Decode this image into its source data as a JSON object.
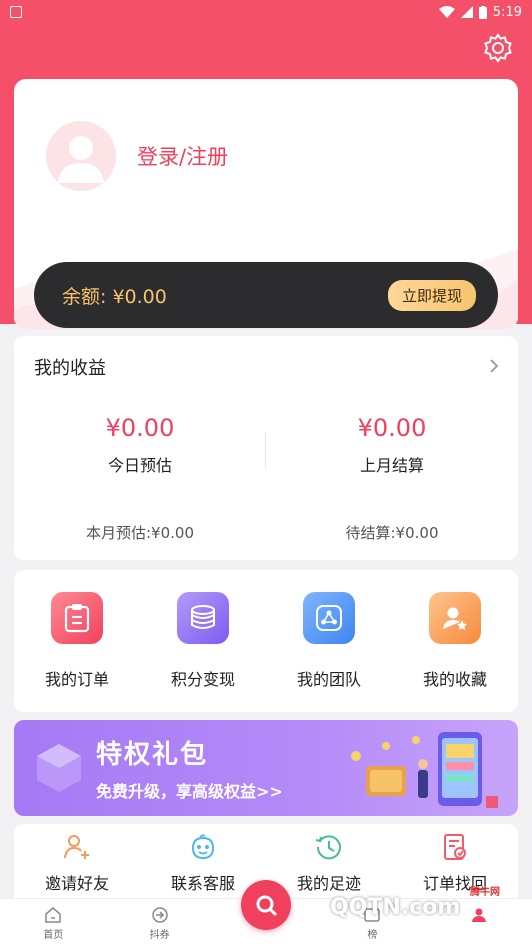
{
  "status_bar": {
    "time": "5:19"
  },
  "profile": {
    "login_label": "登录/注册"
  },
  "balance": {
    "text": "余额: ¥0.00",
    "withdraw_label": "立即提现"
  },
  "earnings": {
    "title": "我的收益",
    "today": {
      "value": "¥0.00",
      "label": "今日预估"
    },
    "last_month": {
      "value": "¥0.00",
      "label": "上月结算"
    },
    "month_estimate": "本月预估:¥0.00",
    "pending": "待结算:¥0.00"
  },
  "shortcuts": [
    {
      "label": "我的订单",
      "icon": "clipboard-icon",
      "color": "#f25a6c"
    },
    {
      "label": "积分变现",
      "icon": "coins-icon",
      "color": "#8e6cf2"
    },
    {
      "label": "我的团队",
      "icon": "share-network-icon",
      "color": "#4a8ff5"
    },
    {
      "label": "我的收藏",
      "icon": "user-star-icon",
      "color": "#f7a25a"
    }
  ],
  "banner": {
    "title": "特权礼包",
    "subtitle": "免费升级，享高级权益>>"
  },
  "tools": [
    {
      "label": "邀请好友",
      "icon": "add-user-icon",
      "color": "#f59a5a"
    },
    {
      "label": "联系客服",
      "icon": "service-face-icon",
      "color": "#4fb8e8"
    },
    {
      "label": "我的足迹",
      "icon": "history-clock-icon",
      "color": "#45c08a"
    },
    {
      "label": "订单找回",
      "icon": "order-find-icon",
      "color": "#f25a6c"
    }
  ],
  "tabbar": [
    {
      "label": "首页",
      "icon": "home-icon"
    },
    {
      "label": "抖券",
      "icon": "coupon-icon"
    },
    {
      "label": "",
      "icon": "search-icon"
    },
    {
      "label": "榜",
      "icon": "rank-icon"
    },
    {
      "label": "",
      "icon": "mine-icon"
    }
  ],
  "watermark": {
    "logo": "QQTN.com",
    "site": "腾牛网"
  },
  "colors": {
    "brand": "#f5506a",
    "accent": "#f0405e",
    "gold": "#f7c36a"
  }
}
